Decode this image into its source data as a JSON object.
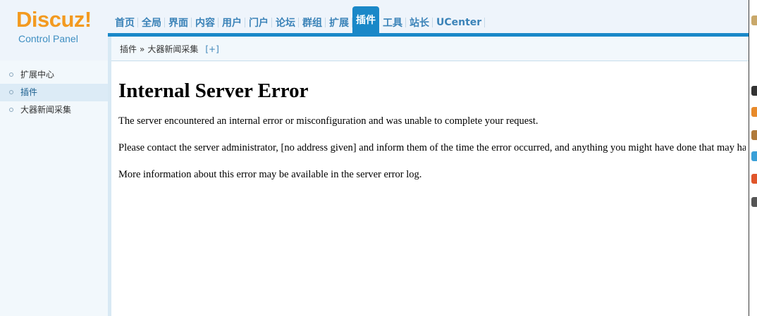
{
  "logo": {
    "word": "Discuz!",
    "subtitle": "Control Panel"
  },
  "nav": {
    "items": [
      "首页",
      "全局",
      "界面",
      "内容",
      "用户",
      "门户",
      "论坛",
      "群组",
      "扩展",
      "插件",
      "工具",
      "站长",
      "UCenter"
    ],
    "active_index": 9
  },
  "breadcrumb": {
    "items": [
      "插件",
      "»",
      "大器新闻采集"
    ],
    "add_label": "[+]"
  },
  "sidebar": {
    "items": [
      {
        "label": "扩展中心"
      },
      {
        "label": "插件"
      },
      {
        "label": "大器新闻采集"
      }
    ],
    "active_index": 1
  },
  "error": {
    "title": "Internal Server Error",
    "p1": "The server encountered an internal error or misconfiguration and was unable to complete your request.",
    "p2": "Please contact the server administrator, [no address given] and inform them of the time the error occurred, and anything you might have done that may have caused the error.",
    "p3": "More information about this error may be available in the server error log."
  },
  "colors": {
    "accent": "#1a88c8",
    "logo": "#f39a20",
    "nav_text": "#3b83b8"
  }
}
